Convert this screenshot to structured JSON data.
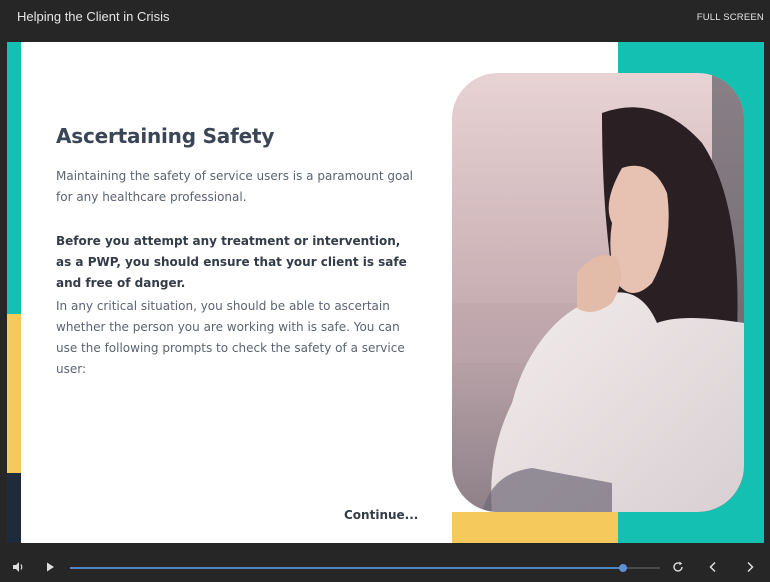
{
  "header": {
    "course_title": "Helping the Client in Crisis",
    "fullscreen_label": "FULL SCREEN"
  },
  "slide": {
    "heading": "Ascertaining Safety",
    "paragraph_1": "Maintaining the safety of service users is a paramount goal for any healthcare professional.",
    "paragraph_2": "Before you attempt any treatment or intervention, as a PWP, you should ensure that your client is safe and free of danger.",
    "paragraph_3": "In any critical situation, you should be able to ascertain whether the person you are working with is safe. You can use the following prompts to check the safety of a service user:",
    "continue_label": "Continue..."
  },
  "playback": {
    "progress": 0.938
  },
  "colors": {
    "teal": "#14c0b1",
    "yellow": "#f5c95c",
    "dark_navy": "#1f2b3a",
    "accent_blue": "#4f86c6"
  },
  "icons": {
    "volume": "speaker-icon",
    "play": "play-icon",
    "replay": "replay-icon",
    "previous": "chevron-left-icon",
    "next": "chevron-right-icon"
  }
}
